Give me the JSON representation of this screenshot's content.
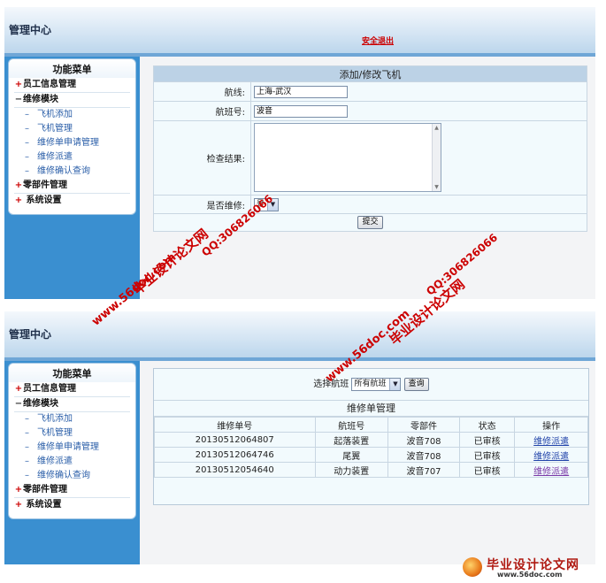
{
  "panel1": {
    "header": {
      "title": "管理中心",
      "logout": "安全退出"
    },
    "menu": {
      "title": "功能菜单",
      "sections": [
        {
          "symbol": "+",
          "label": "员工信息管理"
        },
        {
          "symbol": "−",
          "label": "维修模块"
        },
        {
          "symbol": "+",
          "label": "零部件管理"
        },
        {
          "symbol": "+",
          "label": "系统设置"
        }
      ],
      "items": [
        "飞机添加",
        "飞机管理",
        "维修单申请管理",
        "维修派遣",
        "维修确认查询"
      ]
    },
    "form": {
      "title": "添加/修改飞机",
      "route_label": "航线:",
      "route_value": "上海-武汉",
      "flight_label": "航班号:",
      "flight_value": "波音",
      "result_label": "检查结果:",
      "repair_label": "是否维修:",
      "repair_value": "是",
      "submit": "提交"
    }
  },
  "panel2": {
    "header": {
      "title": "管理中心"
    },
    "menu": {
      "title": "功能菜单",
      "sections": [
        {
          "symbol": "+",
          "label": "员工信息管理"
        },
        {
          "symbol": "−",
          "label": "维修模块"
        },
        {
          "symbol": "+",
          "label": "零部件管理"
        },
        {
          "symbol": "+",
          "label": "系统设置"
        }
      ],
      "items": [
        "飞机添加",
        "飞机管理",
        "维修单申请管理",
        "维修派遣",
        "维修确认查询"
      ]
    },
    "filter": {
      "label": "选择航班",
      "select_value": "所有航班",
      "button": "查询"
    },
    "list": {
      "title": "维修单管理",
      "columns": [
        "维修单号",
        "航班号",
        "零部件",
        "状态",
        "操作"
      ],
      "rows": [
        [
          "20130512064807",
          "起落装置",
          "波音708",
          "已审核",
          "维修派遣"
        ],
        [
          "20130512064746",
          "尾翼",
          "波音708",
          "已审核",
          "维修派遣"
        ],
        [
          "20130512054640",
          "动力装置",
          "波音707",
          "已审核",
          "维修派遣"
        ]
      ]
    }
  },
  "watermarks": {
    "site": "毕业设计论文网",
    "url": "www.56doc.com",
    "qq": "QQ:306826066"
  },
  "logo": {
    "text": "毕业设计论文网",
    "url": "www.56doc.com"
  },
  "colors": {
    "accent": "#3a8fd0",
    "header_bg": "#d6e6f4",
    "logout": "#cc0000",
    "watermark": "#cc0000"
  }
}
